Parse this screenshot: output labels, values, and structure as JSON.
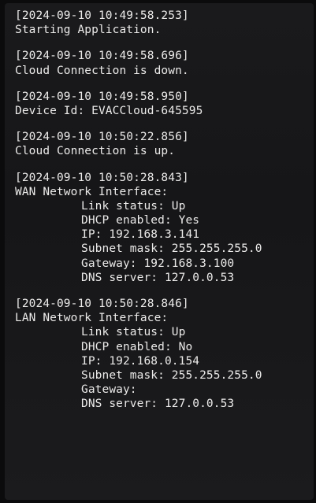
{
  "log": {
    "entries": [
      {
        "timestamp": "[2024-09-10 10:49:58.253]",
        "lines": [
          "Starting Application."
        ]
      },
      {
        "timestamp": "[2024-09-10 10:49:58.696]",
        "lines": [
          "Cloud Connection is down."
        ]
      },
      {
        "timestamp": "[2024-09-10 10:49:58.950]",
        "lines": [
          "Device Id: EVACCloud-645595"
        ]
      },
      {
        "timestamp": "[2024-09-10 10:50:22.856]",
        "lines": [
          "Cloud Connection is up."
        ]
      },
      {
        "timestamp": "[2024-09-10 10:50:28.843]",
        "lines": [
          "WAN Network Interface:"
        ],
        "details": [
          "Link status: Up",
          "DHCP enabled: Yes",
          "IP: 192.168.3.141",
          "Subnet mask: 255.255.255.0",
          "Gateway: 192.168.3.100",
          "DNS server: 127.0.0.53"
        ]
      },
      {
        "timestamp": "[2024-09-10 10:50:28.846]",
        "lines": [
          "LAN Network Interface:"
        ],
        "details": [
          "Link status: Up",
          "DHCP enabled: No",
          "IP: 192.168.0.154",
          "Subnet mask: 255.255.255.0",
          "Gateway:",
          "DNS server: 127.0.0.53"
        ]
      }
    ]
  }
}
